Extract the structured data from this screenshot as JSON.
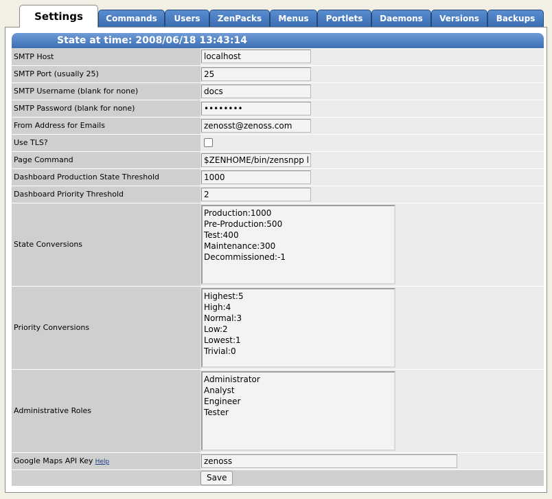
{
  "tabs": [
    {
      "label": "Settings",
      "active": true
    },
    {
      "label": "Commands"
    },
    {
      "label": "Users"
    },
    {
      "label": "ZenPacks"
    },
    {
      "label": "Menus"
    },
    {
      "label": "Portlets"
    },
    {
      "label": "Daemons"
    },
    {
      "label": "Versions"
    },
    {
      "label": "Backups"
    }
  ],
  "panel": {
    "title": "State at time: 2008/06/18 13:43:14"
  },
  "fields": {
    "smtp_host": {
      "label": "SMTP Host",
      "value": "localhost"
    },
    "smtp_port": {
      "label": "SMTP Port (usually 25)",
      "value": "25"
    },
    "smtp_username": {
      "label": "SMTP Username (blank for none)",
      "value": "docs"
    },
    "smtp_password": {
      "label": "SMTP Password (blank for none)",
      "value": "••••••••"
    },
    "from_address": {
      "label": "From Address for Emails",
      "value": "zenosst@zenoss.com"
    },
    "use_tls": {
      "label": "Use TLS?",
      "checked": false
    },
    "page_command": {
      "label": "Page Command",
      "value": "$ZENHOME/bin/zensnpp l"
    },
    "dash_prod_threshold": {
      "label": "Dashboard Production State Threshold",
      "value": "1000"
    },
    "dash_priority_threshold": {
      "label": "Dashboard Priority Threshold",
      "value": "2"
    },
    "state_conversions": {
      "label": "State Conversions",
      "value": "Production:1000\nPre-Production:500\nTest:400\nMaintenance:300\nDecommissioned:-1"
    },
    "priority_conversions": {
      "label": "Priority Conversions",
      "value": "Highest:5\nHigh:4\nNormal:3\nLow:2\nLowest:1\nTrivial:0"
    },
    "admin_roles": {
      "label": "Administrative Roles",
      "value": "Administrator\nAnalyst\nEngineer\nTester"
    },
    "google_maps_key": {
      "label": "Google Maps API Key",
      "help": "Help",
      "value": "zenoss"
    }
  },
  "save_label": "Save"
}
